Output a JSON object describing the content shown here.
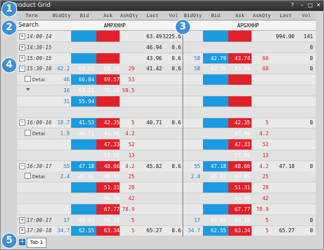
{
  "window": {
    "title": "Product Grid",
    "help": "?",
    "minimize": "–",
    "maximize": "□",
    "close": "✕"
  },
  "columns": [
    "Term",
    "BidQty",
    "Bid",
    "Ask",
    "AskQty",
    "Last",
    "Vol",
    "BidQty",
    "Bid",
    "Ask",
    "AskQty",
    "Last",
    "Vol"
  ],
  "search": {
    "label": "Search",
    "instrument1": "AMPXHHP",
    "instrument2": "APGXHHP"
  },
  "detail_label": "Detai",
  "rows": [
    {
      "exp": "+",
      "term": "14:00-14",
      "c": [
        "",
        "",
        "",
        "",
        "63.49",
        "3225.6",
        "",
        "",
        "",
        "",
        "994.00",
        "141"
      ]
    },
    {
      "exp": "+",
      "term": "14:30-15",
      "c": [
        "",
        "",
        "",
        "",
        "46.94",
        "0.6",
        "",
        "",
        "",
        "",
        "",
        "0"
      ]
    },
    {
      "exp": "+",
      "term": "15:00-15",
      "c": [
        "",
        "",
        "",
        "",
        "43.96",
        "0.6",
        "58",
        "42.79",
        "43.74",
        "60",
        "",
        "0"
      ]
    },
    {
      "exp": "−",
      "term": "15:30-16",
      "c": [
        "42.2",
        "68.65",
        "69.56",
        "29",
        "41.42",
        "0.6",
        "58",
        "42.79",
        "43.74",
        "60",
        "",
        "0"
      ]
    },
    {
      "exp": "",
      "term": "",
      "detail": true,
      "c": [
        "46",
        "66.84",
        "69.57",
        "53",
        "",
        "",
        "",
        "",
        "",
        "",
        "",
        ""
      ]
    },
    {
      "exp": "",
      "term": "",
      "tri": true,
      "c": [
        "16",
        "63.21",
        "70.48",
        "59.5",
        "",
        "",
        "",
        "",
        "",
        "",
        "",
        ""
      ]
    },
    {
      "exp": "",
      "term": "",
      "c": [
        "31",
        "55.94",
        "",
        "",
        "",
        "",
        "",
        "",
        "",
        "",
        "",
        ""
      ]
    },
    {
      "exp": "",
      "term": "",
      "c": [
        "",
        "",
        "",
        "",
        "",
        "",
        "",
        "",
        "",
        "",
        "",
        ""
      ]
    },
    {
      "exp": "−",
      "term": "16:00-16",
      "c": [
        "18.7",
        "41.53",
        "42.35",
        "5",
        "40.71",
        "0.6",
        "",
        "",
        "42.35",
        "5",
        "",
        "0"
      ]
    },
    {
      "exp": "",
      "term": "",
      "detail": true,
      "c": [
        "1.9",
        "40.71",
        "43.96",
        "4.2",
        "",
        "",
        "",
        "",
        "43.96",
        "4.2",
        "",
        ""
      ]
    },
    {
      "exp": "",
      "term": "",
      "c": [
        "",
        "",
        "47.33",
        "52",
        "",
        "",
        "",
        "",
        "47.33",
        "52",
        "",
        ""
      ]
    },
    {
      "exp": "",
      "term": "",
      "c": [
        "",
        "",
        "53.95",
        "13",
        "",
        "",
        "",
        "",
        "53.95",
        "13",
        "",
        ""
      ]
    },
    {
      "exp": "−",
      "term": "16:30-17",
      "c": [
        "55",
        "47.18",
        "48.66",
        "4.2",
        "45.82",
        "0.6",
        "55",
        "47.18",
        "48.66",
        "4.2",
        "47.18",
        "0"
      ]
    },
    {
      "exp": "",
      "term": "",
      "detail": true,
      "c": [
        "2.4",
        "45.82",
        "49.05",
        "25",
        "",
        "",
        "2.4",
        "45.82",
        "49.05",
        "25",
        "",
        ""
      ]
    },
    {
      "exp": "",
      "term": "",
      "c": [
        "",
        "",
        "51.31",
        "28",
        "",
        "",
        "",
        "",
        "51.31",
        "28",
        "",
        ""
      ]
    },
    {
      "exp": "",
      "term": "",
      "c": [
        "",
        "",
        "56.79",
        "42",
        "",
        "",
        "",
        "",
        "56.79",
        "42",
        "",
        ""
      ]
    },
    {
      "exp": "",
      "term": "",
      "c": [
        "",
        "",
        "67.77",
        "78.9",
        "",
        "",
        "",
        "",
        "67.77",
        "78.9",
        "",
        ""
      ]
    },
    {
      "exp": "+",
      "term": "17:00-17",
      "c": [
        "17",
        "49.03",
        "50.18",
        "5",
        "",
        "",
        "17",
        "49.03",
        "50.18",
        "5",
        "",
        "0"
      ]
    },
    {
      "exp": "+",
      "term": "17:30-18",
      "c": [
        "34.7",
        "62.55",
        "63.34",
        "5",
        "65.27",
        "0.6",
        "34.7",
        "62.55",
        "63.34",
        "5",
        "65.27",
        "0"
      ]
    }
  ],
  "tabs": {
    "add": "+",
    "tab1": "Tab 1"
  },
  "badges": [
    "1",
    "2",
    "3",
    "4",
    "5"
  ],
  "colors": {
    "bid_column": "#1a9ae0",
    "ask_column": "#e2202a",
    "badge": "#3d8fd6",
    "bid_qty_text": "#1a7ad0",
    "ask_qty_text": "#d02020"
  }
}
